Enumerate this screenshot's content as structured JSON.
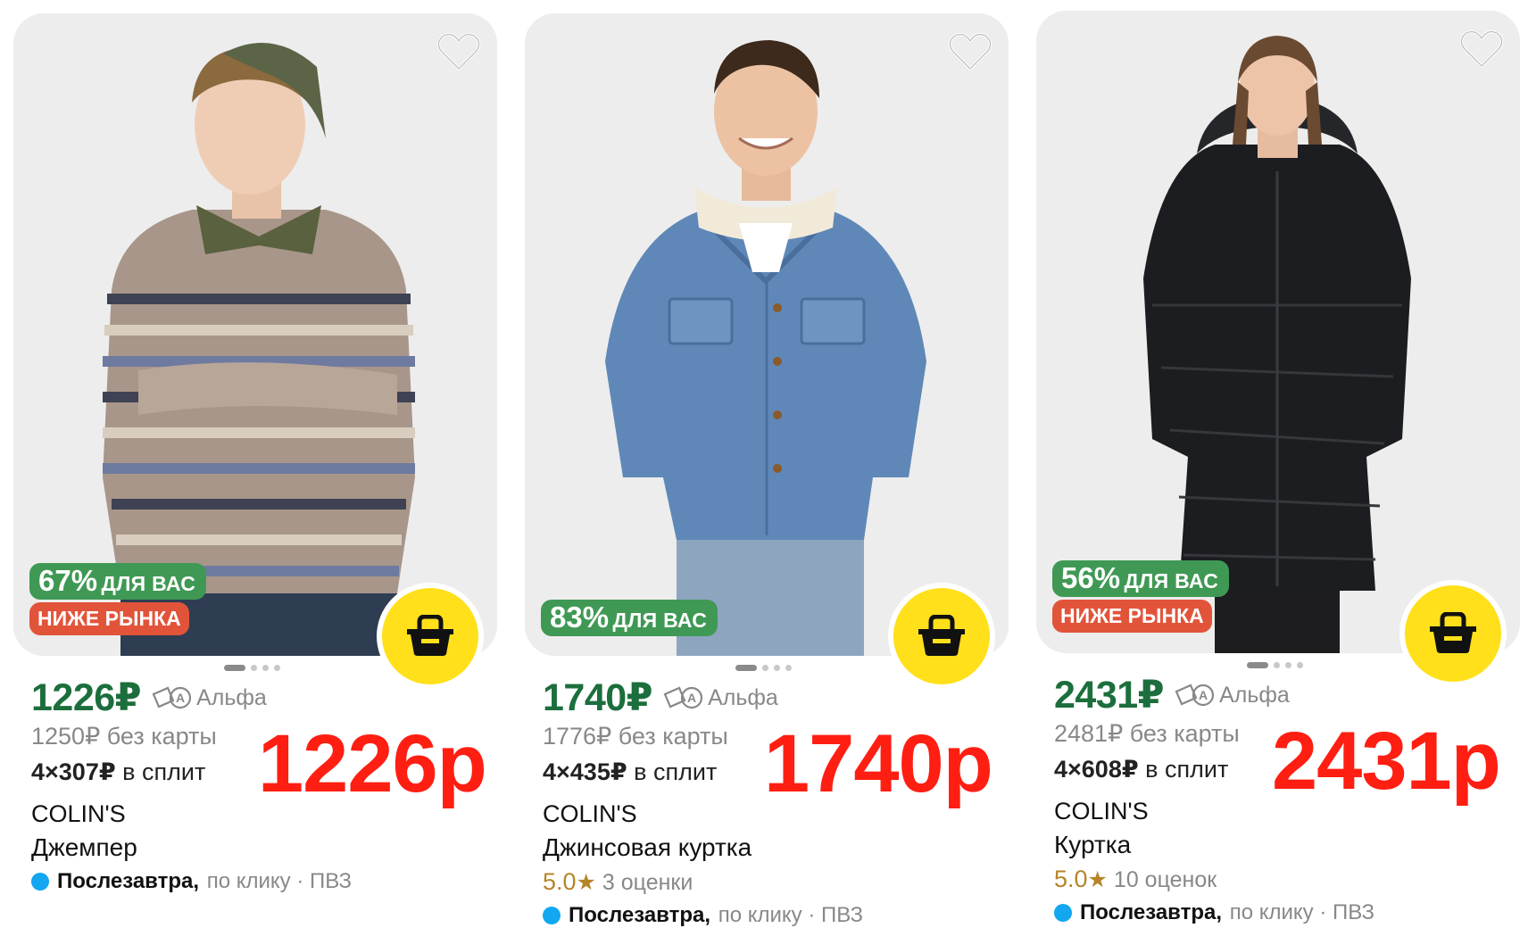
{
  "colors": {
    "discount_badge": "#3f9954",
    "below_market_badge": "#e2543a",
    "price_green": "#1c6e3c",
    "cart_yellow": "#ffe01a",
    "overlay_red": "#ff1e12",
    "delivery_dot": "#12a7f0",
    "rating_gold": "#b5852a"
  },
  "icons": {
    "favorite": "heart-outline-icon",
    "cart": "basket-icon",
    "bank": "alfa-card-icon",
    "delivery": "blue-dot-icon",
    "rating": "star-icon"
  },
  "products": [
    {
      "discount_num": "67%",
      "discount_text": "ДЛЯ ВАС",
      "below_market": "НИЖЕ РЫНКА",
      "price": "1226₽",
      "bank": "Альфа",
      "old_price": "1250₽ без карты",
      "split_amount": "4×307₽",
      "split_text": "в сплит",
      "brand": "COLIN'S",
      "title": "Джемпер",
      "delivery_day": "Послезавтра,",
      "delivery_rest": "по клику · ПВЗ",
      "overlay_price": "1226р",
      "image_slide": 1,
      "image_slides_total": 4
    },
    {
      "discount_num": "83%",
      "discount_text": "ДЛЯ ВАС",
      "price": "1740₽",
      "bank": "Альфа",
      "old_price": "1776₽ без карты",
      "split_amount": "4×435₽",
      "split_text": "в сплит",
      "brand": "COLIN'S",
      "title": "Джинсовая куртка",
      "rating": "5.0",
      "rating_star": "★",
      "rating_count": "3 оценки",
      "delivery_day": "Послезавтра,",
      "delivery_rest": "по клику · ПВЗ",
      "overlay_price": "1740р",
      "image_slide": 1,
      "image_slides_total": 4
    },
    {
      "discount_num": "56%",
      "discount_text": "ДЛЯ ВАС",
      "below_market": "НИЖЕ РЫНКА",
      "price": "2431₽",
      "bank": "Альфа",
      "old_price": "2481₽ без карты",
      "split_amount": "4×608₽",
      "split_text": "в сплит",
      "brand": "COLIN'S",
      "title": "Куртка",
      "rating": "5.0",
      "rating_star": "★",
      "rating_count": "10 оценок",
      "delivery_day": "Послезавтра,",
      "delivery_rest": "по клику · ПВЗ",
      "overlay_price": "2431р",
      "image_slide": 1,
      "image_slides_total": 4
    }
  ]
}
